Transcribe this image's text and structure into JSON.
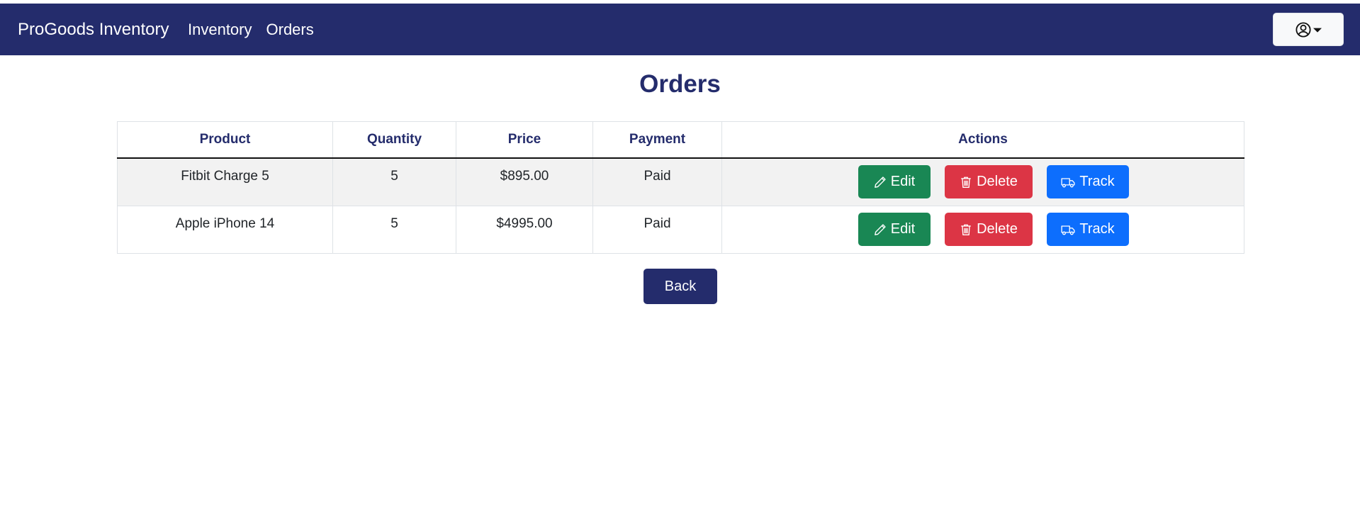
{
  "navbar": {
    "brand": "ProGoods Inventory",
    "links": [
      {
        "label": "Inventory"
      },
      {
        "label": "Orders"
      }
    ],
    "user_menu_icon": "user-circle-icon"
  },
  "page": {
    "title": "Orders"
  },
  "table": {
    "columns": [
      "Product",
      "Quantity",
      "Price",
      "Payment",
      "Actions"
    ],
    "rows": [
      {
        "product": "Fitbit Charge 5",
        "quantity": "5",
        "price": "$895.00",
        "payment": "Paid"
      },
      {
        "product": "Apple iPhone 14",
        "quantity": "5",
        "price": "$4995.00",
        "payment": "Paid"
      }
    ],
    "actions": {
      "edit_label": "Edit",
      "delete_label": "Delete",
      "track_label": "Track"
    }
  },
  "back_label": "Back",
  "colors": {
    "navbar": "#242c6c",
    "edit": "#198754",
    "delete": "#dc3545",
    "track": "#0d6efd"
  }
}
